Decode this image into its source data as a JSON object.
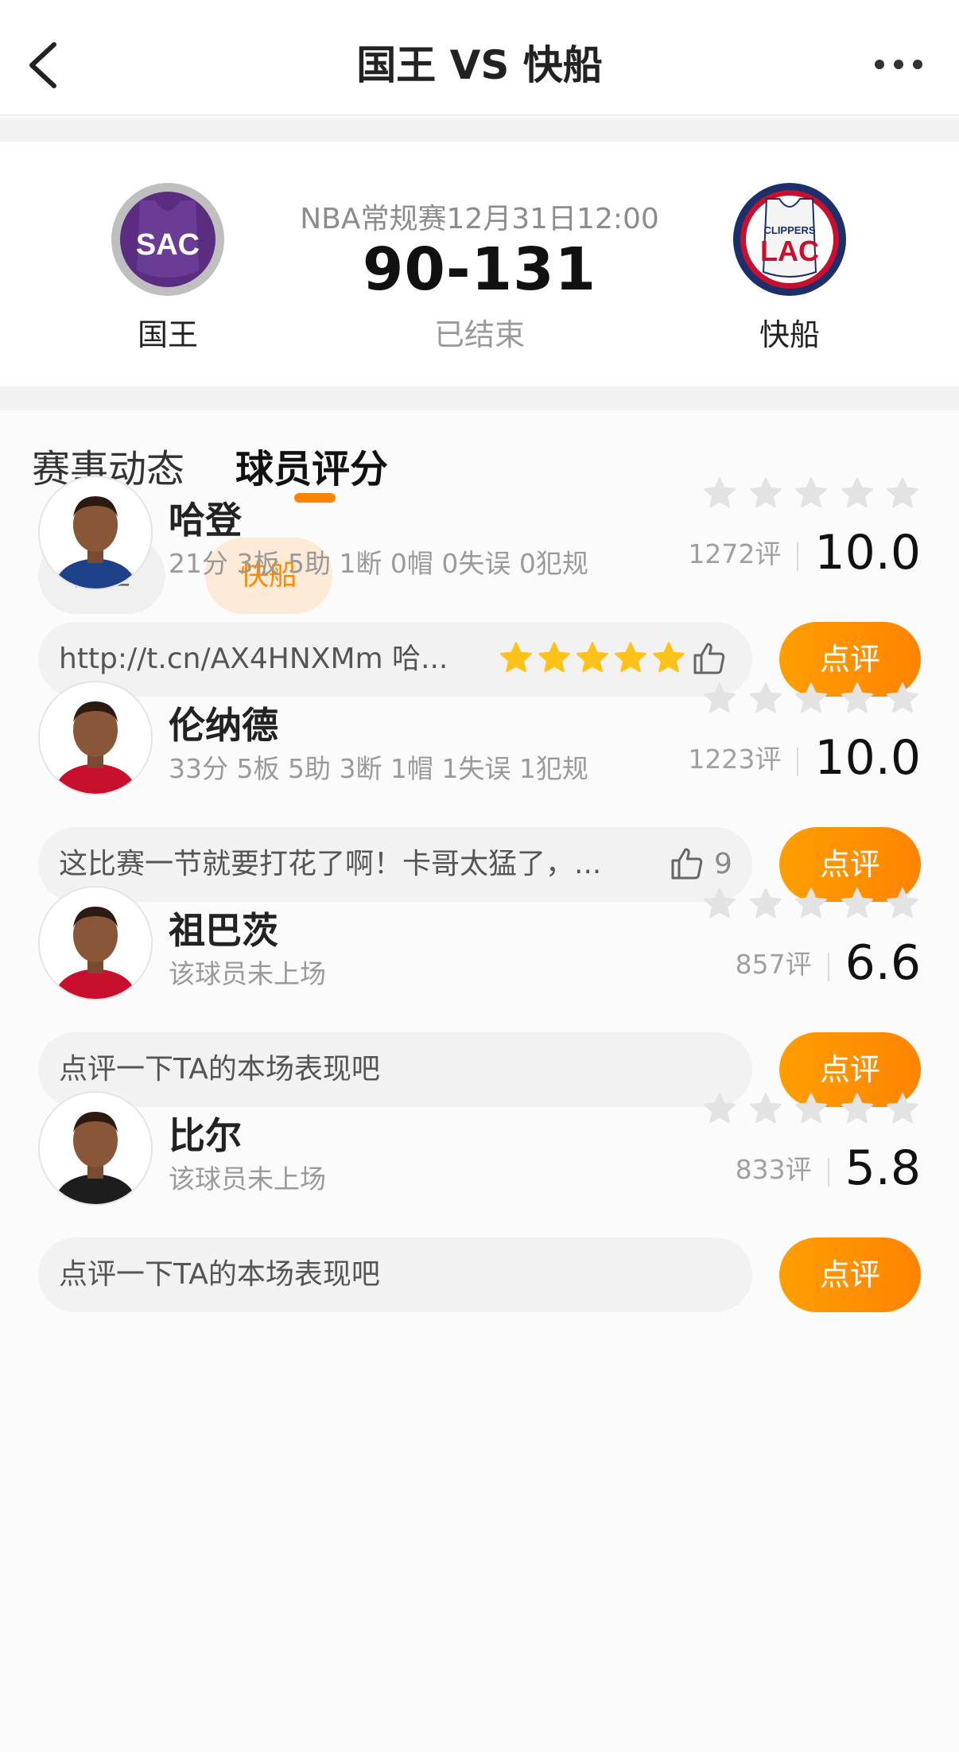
{
  "nav": {
    "title": "国王 VS 快船"
  },
  "match": {
    "meta": "NBA常规赛12月31日12:00",
    "score": "90-131",
    "status": "已结束",
    "home": {
      "name": "国王",
      "logo_text": "SAC",
      "color": "#5a2d81"
    },
    "away": {
      "name": "快船",
      "logo_text": "LAC",
      "logo_small_text": "CLIPPERS",
      "color": "#c8102e"
    }
  },
  "tabs": [
    {
      "label": "赛事动态",
      "active": false
    },
    {
      "label": "球员评分",
      "active": true
    }
  ],
  "team_filter": [
    {
      "label": "国王",
      "active": false
    },
    {
      "label": "快船",
      "active": true
    }
  ],
  "colors": {
    "accent": "#ff8400",
    "star_empty": "#e3e3e3",
    "star_filled": "#ffc21a"
  },
  "players": [
    {
      "name": "哈登",
      "stats": "21分 3板 5助 1断 0帽 0失误 0犯规",
      "review_count": "1272评",
      "score": "10.0",
      "comment": "http://t.cn/AX4HNXMm 哈...",
      "comment_rating": 5,
      "likes": "",
      "review_label": "点评",
      "jersey": "#1d428a"
    },
    {
      "name": "伦纳德",
      "stats": "33分 5板 5助 3断 1帽 1失误 1犯规",
      "review_count": "1223评",
      "score": "10.0",
      "comment": "这比赛一节就要打花了啊！卡哥太猛了，...",
      "comment_rating": 0,
      "likes": "9",
      "review_label": "点评",
      "jersey": "#c8102e"
    },
    {
      "name": "祖巴茨",
      "stats": "该球员未上场",
      "review_count": "857评",
      "score": "6.6",
      "comment": "点评一下TA的本场表现吧",
      "comment_rating": 0,
      "likes": "",
      "review_label": "点评",
      "jersey": "#c8102e"
    },
    {
      "name": "比尔",
      "stats": "该球员未上场",
      "review_count": "833评",
      "score": "5.8",
      "comment": "点评一下TA的本场表现吧",
      "comment_rating": 0,
      "likes": "",
      "review_label": "点评",
      "jersey": "#1d1d1d"
    }
  ]
}
